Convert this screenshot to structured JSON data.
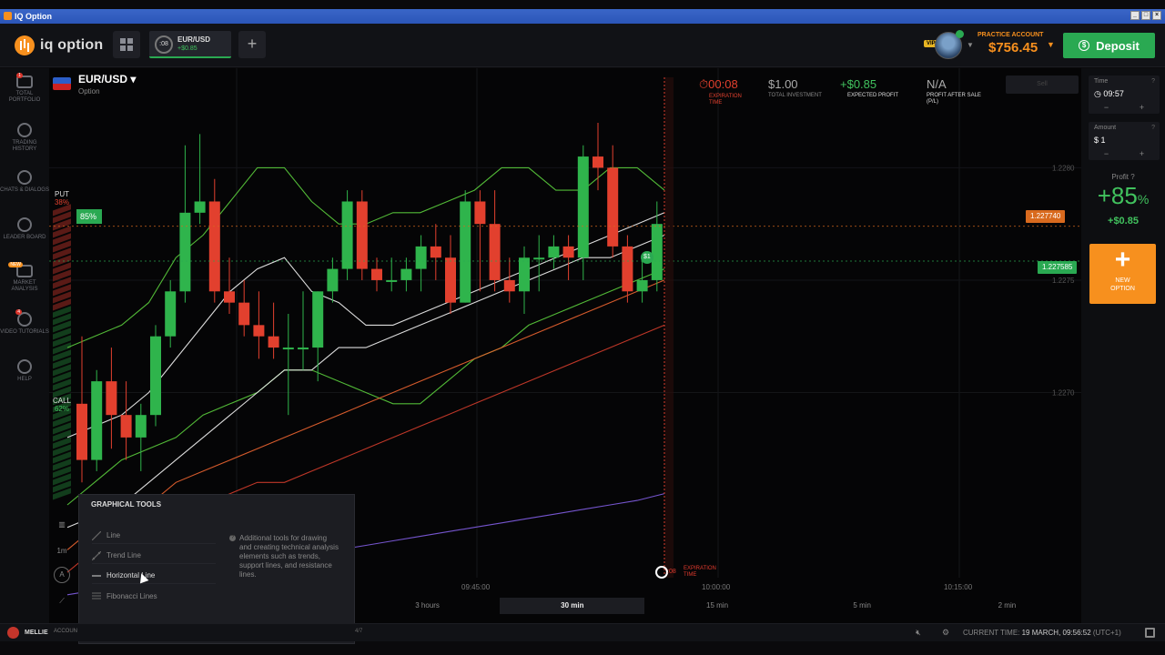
{
  "window": {
    "title": "IQ Option"
  },
  "header": {
    "logo_text": "iq option",
    "asset_tab": {
      "timer": ":08",
      "name": "EUR/USD",
      "profit": "+$0.85"
    },
    "account_type": "PRACTICE ACCOUNT",
    "balance": "$756.45",
    "vip_badge": "VIP",
    "deposit_label": "Deposit"
  },
  "sidebar": {
    "items": [
      {
        "label": "TOTAL PORTFOLIO",
        "icon": "portfolio-icon",
        "badge": "1"
      },
      {
        "label": "TRADING HISTORY",
        "icon": "history-icon"
      },
      {
        "label": "CHATS & DIALOGS",
        "icon": "chat-icon"
      },
      {
        "label": "LEADER BOARD",
        "icon": "leaderboard-icon"
      },
      {
        "label": "MARKET ANALYSIS",
        "icon": "market-analysis-icon",
        "badge": "NEW"
      },
      {
        "label": "VIDEO TUTORIALS",
        "icon": "video-icon",
        "badge": "4"
      },
      {
        "label": "HELP",
        "icon": "help-icon"
      }
    ]
  },
  "asset": {
    "name": "EUR/USD",
    "type": "Option"
  },
  "trade_stats": {
    "expiration_time": {
      "value": "00:08",
      "label": "EXPIRATION TIME"
    },
    "total_investment": {
      "value": "$1.00",
      "label": "TOTAL INVESTMENT"
    },
    "expected_profit": {
      "value": "+$0.85",
      "label": "EXPECTED PROFIT"
    },
    "profit_after_sale": {
      "value": "N/A",
      "label": "PROFIT AFTER SALE (P/L)"
    },
    "sell_label": "Sell"
  },
  "right_panel": {
    "time": {
      "label": "Time",
      "value": "09:57"
    },
    "amount": {
      "label": "Amount",
      "value": "$ 1"
    },
    "profit_label": "Profit",
    "profit_pct": "+85",
    "profit_pct_suffix": "%",
    "profit_amount": "+$0.85",
    "new_option_label": "NEW OPTION"
  },
  "chart": {
    "price_levels": [
      "1.2280",
      "1.2275",
      "1.2270"
    ],
    "current_price_tag": "1.227740",
    "entry_price_tag": "1.227585",
    "deal_marker": "$1",
    "put": {
      "label": "PUT",
      "pct": "38%"
    },
    "call": {
      "label": "CALL",
      "pct": "62%"
    },
    "payout_tag": "85%",
    "time_labels": [
      "09:45:00",
      "10:00:00",
      "10:15:00"
    ],
    "expiration_timer": ":08",
    "expiration_label": "EXPIRATION TIME",
    "candle_interval": "1m"
  },
  "chart_data": {
    "type": "candlestick",
    "timeframe": "30 min",
    "candle_interval": "1m",
    "ylim": [
      1.2265,
      1.2282
    ],
    "y_ticks": [
      1.228,
      1.2275,
      1.227
    ],
    "x_ticks": [
      "09:45:00",
      "10:00:00",
      "10:15:00"
    ],
    "current_price": 1.22774,
    "entry_price": 1.227585,
    "candles": [
      {
        "o": 1.22695,
        "h": 1.22725,
        "c": 1.2267,
        "l": 1.2266
      },
      {
        "o": 1.2267,
        "h": 1.2271,
        "c": 1.22705,
        "l": 1.22665
      },
      {
        "o": 1.22705,
        "h": 1.2272,
        "c": 1.2269,
        "l": 1.22675
      },
      {
        "o": 1.2269,
        "h": 1.22705,
        "c": 1.2268,
        "l": 1.2267
      },
      {
        "o": 1.2268,
        "h": 1.22695,
        "c": 1.2269,
        "l": 1.22665
      },
      {
        "o": 1.2269,
        "h": 1.2273,
        "c": 1.22725,
        "l": 1.22685
      },
      {
        "o": 1.22725,
        "h": 1.2275,
        "c": 1.22745,
        "l": 1.2272
      },
      {
        "o": 1.22745,
        "h": 1.2281,
        "c": 1.2278,
        "l": 1.2274
      },
      {
        "o": 1.2278,
        "h": 1.22815,
        "c": 1.22785,
        "l": 1.22775
      },
      {
        "o": 1.22785,
        "h": 1.22795,
        "c": 1.22745,
        "l": 1.2274
      },
      {
        "o": 1.22745,
        "h": 1.2276,
        "c": 1.2274,
        "l": 1.22735
      },
      {
        "o": 1.2274,
        "h": 1.2275,
        "c": 1.2273,
        "l": 1.22725
      },
      {
        "o": 1.2273,
        "h": 1.22745,
        "c": 1.22725,
        "l": 1.22715
      },
      {
        "o": 1.22725,
        "h": 1.2274,
        "c": 1.2272,
        "l": 1.22715
      },
      {
        "o": 1.2272,
        "h": 1.22735,
        "c": 1.2272,
        "l": 1.2269
      },
      {
        "o": 1.2272,
        "h": 1.22745,
        "c": 1.2272,
        "l": 1.2271
      },
      {
        "o": 1.2272,
        "h": 1.22745,
        "c": 1.22745,
        "l": 1.22705
      },
      {
        "o": 1.22745,
        "h": 1.2276,
        "c": 1.22755,
        "l": 1.2274
      },
      {
        "o": 1.22755,
        "h": 1.2279,
        "c": 1.22785,
        "l": 1.2275
      },
      {
        "o": 1.22785,
        "h": 1.2279,
        "c": 1.22755,
        "l": 1.2275
      },
      {
        "o": 1.22755,
        "h": 1.2276,
        "c": 1.2275,
        "l": 1.22745
      },
      {
        "o": 1.2275,
        "h": 1.2276,
        "c": 1.2275,
        "l": 1.22745
      },
      {
        "o": 1.2275,
        "h": 1.2276,
        "c": 1.22755,
        "l": 1.22745
      },
      {
        "o": 1.22755,
        "h": 1.2277,
        "c": 1.22765,
        "l": 1.22745
      },
      {
        "o": 1.22765,
        "h": 1.22775,
        "c": 1.2276,
        "l": 1.2275
      },
      {
        "o": 1.2276,
        "h": 1.2277,
        "c": 1.2274,
        "l": 1.22735
      },
      {
        "o": 1.2274,
        "h": 1.2279,
        "c": 1.22785,
        "l": 1.2274
      },
      {
        "o": 1.22785,
        "h": 1.2279,
        "c": 1.22775,
        "l": 1.22745
      },
      {
        "o": 1.22775,
        "h": 1.2279,
        "c": 1.2275,
        "l": 1.22745
      },
      {
        "o": 1.2275,
        "h": 1.2276,
        "c": 1.22745,
        "l": 1.2274
      },
      {
        "o": 1.22745,
        "h": 1.22765,
        "c": 1.2276,
        "l": 1.22735
      },
      {
        "o": 1.2276,
        "h": 1.2277,
        "c": 1.2276,
        "l": 1.22745
      },
      {
        "o": 1.2276,
        "h": 1.2277,
        "c": 1.22765,
        "l": 1.22755
      },
      {
        "o": 1.22765,
        "h": 1.2277,
        "c": 1.2276,
        "l": 1.2275
      },
      {
        "o": 1.2276,
        "h": 1.2281,
        "c": 1.22805,
        "l": 1.2275
      },
      {
        "o": 1.22805,
        "h": 1.2282,
        "c": 1.228,
        "l": 1.2279
      },
      {
        "o": 1.228,
        "h": 1.2281,
        "c": 1.22765,
        "l": 1.2276
      },
      {
        "o": 1.22765,
        "h": 1.2277,
        "c": 1.22745,
        "l": 1.2274
      },
      {
        "o": 1.22745,
        "h": 1.2276,
        "c": 1.2275,
        "l": 1.2274
      },
      {
        "o": 1.2275,
        "h": 1.22785,
        "c": 1.22775,
        "l": 1.22745
      }
    ],
    "overlays": [
      {
        "name": "upper-band",
        "color": "#56c43a",
        "values": [
          1.2272,
          1.22725,
          1.2273,
          1.2274,
          1.2276,
          1.2277,
          1.22785,
          1.228,
          1.228,
          1.22785,
          1.22775,
          1.22775,
          1.2278,
          1.2278,
          1.22785,
          1.2279,
          1.228,
          1.228,
          1.2279,
          1.2279,
          1.228,
          1.228,
          1.2279
        ]
      },
      {
        "name": "mid-line",
        "color": "#e8e8e8",
        "values": [
          1.2268,
          1.22685,
          1.2269,
          1.227,
          1.22715,
          1.2273,
          1.22745,
          1.22755,
          1.2276,
          1.22745,
          1.2274,
          1.2273,
          1.2273,
          1.22735,
          1.2274,
          1.22745,
          1.2275,
          1.22755,
          1.2276,
          1.22765,
          1.2277,
          1.22775,
          1.2278
        ]
      },
      {
        "name": "lower-band",
        "color": "#56c43a",
        "values": [
          1.2265,
          1.2266,
          1.2267,
          1.22675,
          1.2268,
          1.2269,
          1.22695,
          1.227,
          1.2271,
          1.2271,
          1.22705,
          1.227,
          1.22695,
          1.22695,
          1.22705,
          1.22715,
          1.2272,
          1.2273,
          1.22735,
          1.2274,
          1.22745,
          1.2275,
          1.22755
        ]
      },
      {
        "name": "slow-ma",
        "color": "#e8e8e8",
        "values": [
          1.2264,
          1.22645,
          1.2265,
          1.2266,
          1.2267,
          1.2268,
          1.2269,
          1.227,
          1.2271,
          1.2271,
          1.2272,
          1.2272,
          1.22725,
          1.2273,
          1.22735,
          1.2274,
          1.22745,
          1.2275,
          1.22755,
          1.2276,
          1.2276,
          1.22765,
          1.2277
        ]
      },
      {
        "name": "orange-ma",
        "color": "#e2602e",
        "values": [
          1.2263,
          1.2264,
          1.22645,
          1.2265,
          1.2266,
          1.22665,
          1.2267,
          1.22675,
          1.2268,
          1.22685,
          1.2269,
          1.22695,
          1.227,
          1.22705,
          1.2271,
          1.22715,
          1.2272,
          1.22725,
          1.2273,
          1.22735,
          1.2274,
          1.22745,
          1.2275
        ]
      },
      {
        "name": "red-ma",
        "color": "#c93a2a",
        "values": [
          1.2262,
          1.2263,
          1.2263,
          1.2264,
          1.22645,
          1.2265,
          1.22655,
          1.2266,
          1.2266,
          1.22665,
          1.2267,
          1.22675,
          1.2268,
          1.22685,
          1.2269,
          1.22695,
          1.227,
          1.22705,
          1.2271,
          1.22715,
          1.2272,
          1.22725,
          1.2273
        ]
      },
      {
        "name": "purple-ma",
        "color": "#7b5ad9",
        "values": [
          1.2261,
          1.22612,
          1.22614,
          1.22616,
          1.22618,
          1.2262,
          1.22622,
          1.22624,
          1.22626,
          1.22628,
          1.2263,
          1.22632,
          1.22634,
          1.22636,
          1.22638,
          1.2264,
          1.22642,
          1.22644,
          1.22646,
          1.22648,
          1.2265,
          1.22652,
          1.22655
        ]
      }
    ]
  },
  "graphical_tools": {
    "title": "GRAPHICAL TOOLS",
    "items": [
      {
        "label": "Line",
        "icon": "line-tool-icon"
      },
      {
        "label": "Trend Line",
        "icon": "trend-line-icon"
      },
      {
        "label": "Horizontal Line",
        "icon": "horizontal-line-icon"
      },
      {
        "label": "Fibonacci Lines",
        "icon": "fibonacci-icon"
      }
    ],
    "description": "Additional tools for drawing and creating technical analysis elements such as trends, support lines, and resistance lines."
  },
  "timeframes": [
    "3 hours",
    "30 min",
    "15 min",
    "5 min",
    "2 min"
  ],
  "active_timeframe": "30 min",
  "footer": {
    "user": "MELLIE",
    "account": "ACCOUN",
    "pager": "4/7",
    "current_time_label": "CURRENT TIME:",
    "current_time_value": "19 MARCH, 09:56:52",
    "timezone": "(UTC+1)"
  },
  "colors": {
    "accent": "#f7901e",
    "green": "#2aa952",
    "red": "#e2402e"
  }
}
